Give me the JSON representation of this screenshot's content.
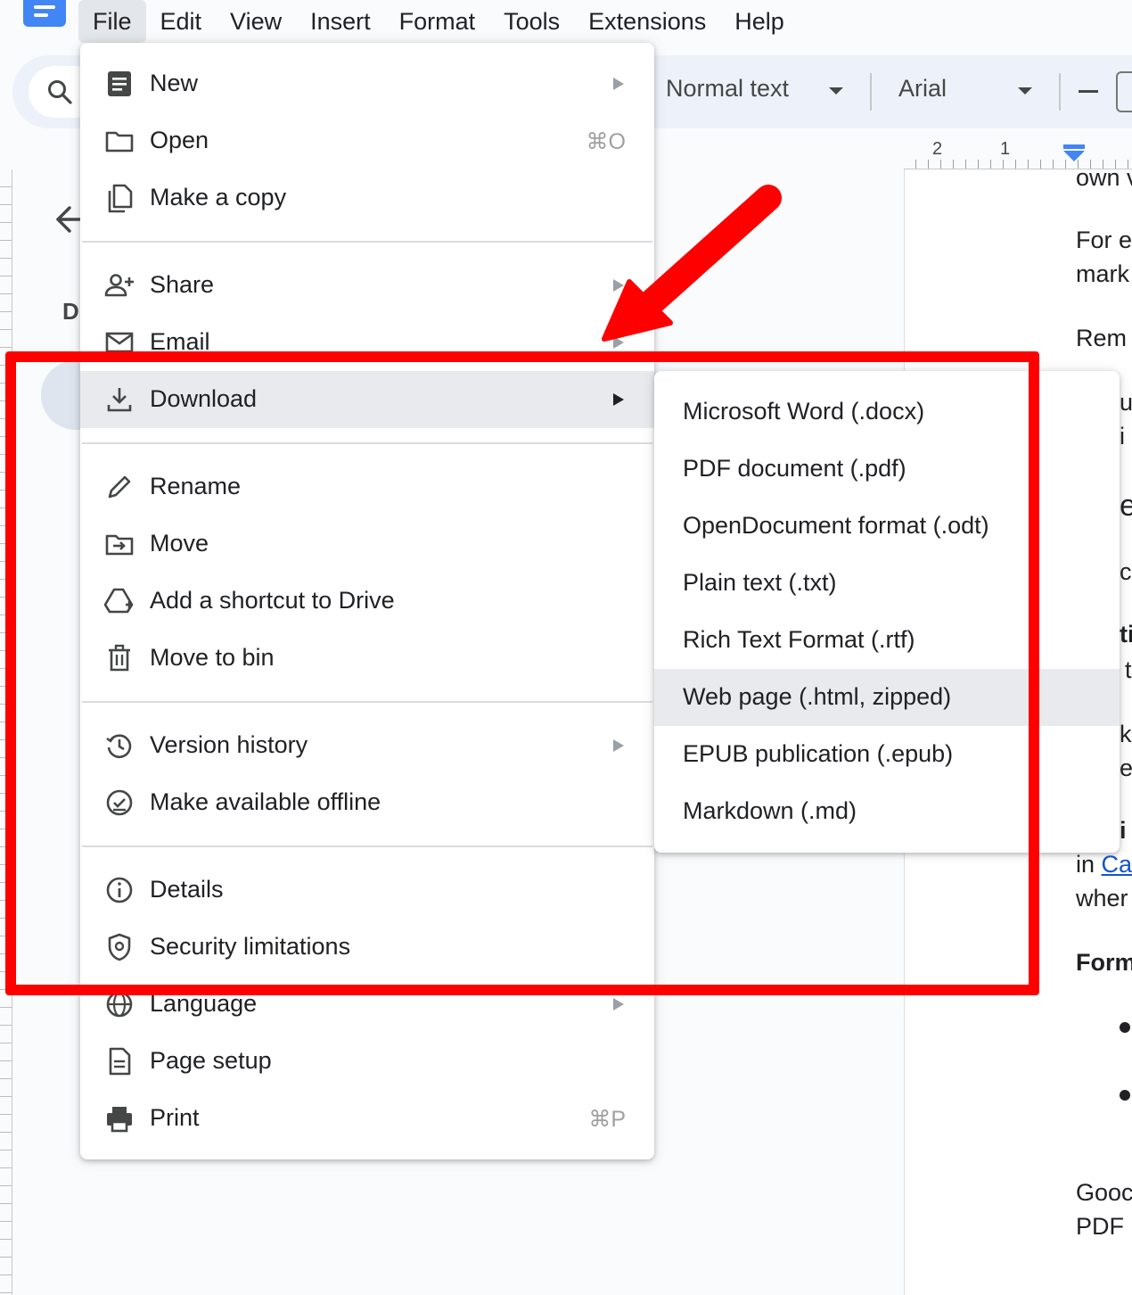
{
  "menubar": {
    "items": [
      "File",
      "Edit",
      "View",
      "Insert",
      "Format",
      "Tools",
      "Extensions",
      "Help"
    ],
    "active": "File"
  },
  "toolbar": {
    "style_value": "Normal text",
    "font_value": "Arial"
  },
  "sidebar": {
    "letter": "D"
  },
  "ruler": {
    "labels": [
      "2",
      "1"
    ]
  },
  "document": {
    "lines": [
      "own v",
      "For e",
      "mark",
      "Rem",
      "in ",
      "wher",
      "Form",
      "Gooc",
      "PDF"
    ],
    "link_text": "Ca",
    "partial_glyphs": [
      "u",
      "i",
      "e",
      "c",
      "ti",
      "t",
      "k",
      "e",
      "i"
    ]
  },
  "file_menu": {
    "items": [
      {
        "label": "New",
        "icon": "new-document-icon",
        "has_submenu": true
      },
      {
        "label": "Open",
        "icon": "folder-icon",
        "shortcut": "⌘O"
      },
      {
        "label": "Make a copy",
        "icon": "copy-icon"
      },
      {
        "label": "Share",
        "icon": "share-person-icon",
        "has_submenu": true
      },
      {
        "label": "Email",
        "icon": "email-icon",
        "has_submenu": true
      },
      {
        "label": "Download",
        "icon": "download-icon",
        "has_submenu": true,
        "highlighted": true
      },
      {
        "label": "Rename",
        "icon": "pencil-icon"
      },
      {
        "label": "Move",
        "icon": "move-folder-icon"
      },
      {
        "label": "Add a shortcut to Drive",
        "icon": "drive-shortcut-icon"
      },
      {
        "label": "Move to bin",
        "icon": "trash-icon"
      },
      {
        "label": "Version history",
        "icon": "history-icon",
        "has_submenu": true
      },
      {
        "label": "Make available offline",
        "icon": "offline-check-icon"
      },
      {
        "label": "Details",
        "icon": "info-icon"
      },
      {
        "label": "Security limitations",
        "icon": "shield-icon"
      },
      {
        "label": "Language",
        "icon": "globe-icon",
        "has_submenu": true
      },
      {
        "label": "Page setup",
        "icon": "page-setup-icon"
      },
      {
        "label": "Print",
        "icon": "printer-icon",
        "shortcut": "⌘P"
      }
    ]
  },
  "download_submenu": {
    "items": [
      "Microsoft Word (.docx)",
      "PDF document (.pdf)",
      "OpenDocument format (.odt)",
      "Plain text (.txt)",
      "Rich Text Format (.rtf)",
      "Web page (.html, zipped)",
      "EPUB publication (.epub)",
      "Markdown (.md)"
    ],
    "hovered": "Web page (.html, zipped)"
  },
  "annotation": {
    "color": "#ff0000"
  },
  "colors": {
    "toolbar_bg": "#edf2fa",
    "menu_highlight": "#e8eaed",
    "accent": "#4285f4",
    "link": "#1155cc"
  }
}
